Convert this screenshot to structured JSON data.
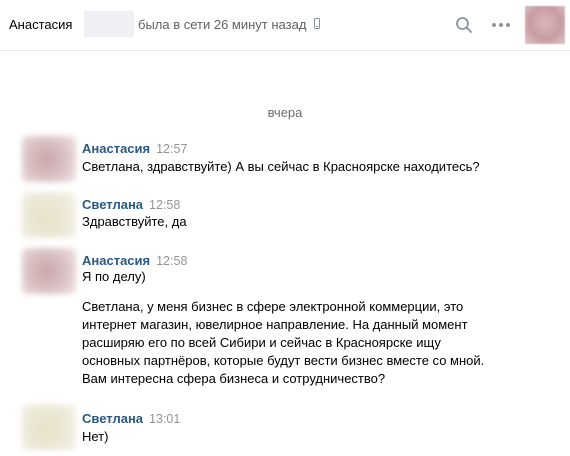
{
  "header": {
    "contact_name": "Анастасия",
    "status": "была в сети 26 минут назад",
    "icons": [
      "phone-icon",
      "search-icon",
      "more-icon"
    ]
  },
  "day_separator": "вчера",
  "messages": [
    {
      "author": "Анастасия",
      "time": "12:57",
      "text": "Светлана, здравствуйте) А вы сейчас в Красноярске находитесь?"
    },
    {
      "author": "Светлана",
      "time": "12:58",
      "text": "Здравствуйте, да"
    },
    {
      "author": "Анастасия",
      "time": "12:58",
      "text": "Я по делу)",
      "text2": "Светлана, у меня бизнес в сфере электронной коммерции, это\nинтернет магазин, ювелирное направление. На данный момент\nрасширяю его по всей Сибири и сейчас в Красноярске ищу\nосновных партнёров, которые будут вести бизнес вместе со мной.\nВам интересна сфера бизнеса и сотрудничество?"
    },
    {
      "author": "Светлана",
      "time": "13:01",
      "text": "Нет)"
    }
  ],
  "colors": {
    "author": "#2a5885",
    "time": "#939699",
    "status": "#5e6166"
  }
}
